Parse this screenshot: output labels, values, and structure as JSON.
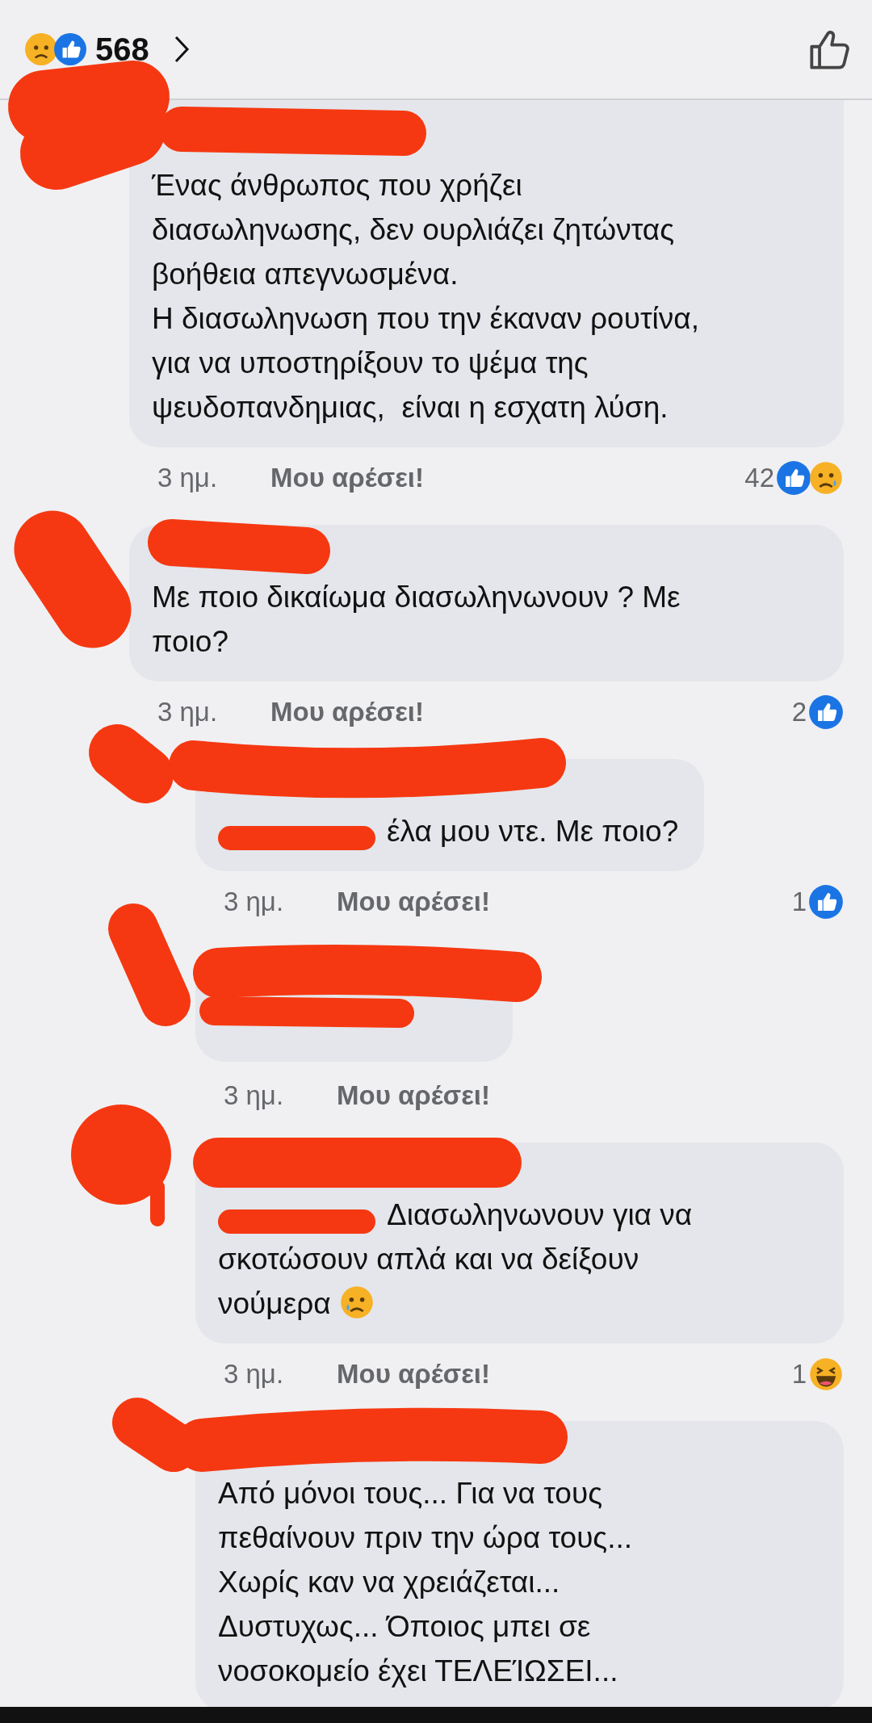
{
  "header": {
    "reactions": [
      {
        "kind": "sad"
      },
      {
        "kind": "like"
      }
    ],
    "count": "568"
  },
  "comments": [
    {
      "text": "Ένας άνθρωπος που χρήζει\nδιασωληνωσης, δεν ουρλιάζει ζητώντας\nβοήθεια απεγνωσμένα.\nΗ διασωληνωση που την έκαναν ρουτίνα,\nγια να υποστηρίξουν το ψέμα της\nψευδοπανδημιας,  είναι η εσχατη λύση.",
      "cut_top": true,
      "mention_hidden": false,
      "time": "3 ημ.",
      "like": "Μου αρέσει!",
      "reaction_count": "42",
      "reactions": [
        {
          "kind": "like"
        },
        {
          "kind": "sad"
        }
      ]
    },
    {
      "text": "Με ποιο δικαίωμα διασωληνωνουν ? Με\nποιο?",
      "cut_top": false,
      "mention_hidden": false,
      "time": "3 ημ.",
      "like": "Μου αρέσει!",
      "reaction_count": "2",
      "reactions": [
        {
          "kind": "like"
        }
      ],
      "children": [
        {
          "text": "έλα μου ντε. Με ποιο?",
          "cut_top": false,
          "mention_hidden": true,
          "time": "3 ημ.",
          "like": "Μου αρέσει!",
          "reaction_count": "1",
          "reactions": [
            {
              "kind": "like"
            }
          ]
        },
        {
          "cut_top": false,
          "mention_hidden": false,
          "time": "3 ημ.",
          "like": "Μου αρέσει!"
        },
        {
          "text": "Διασωληνωνουν για να\nσκοτώσουν απλά και να δείξουν\nνούμερα",
          "emoji": [
            {
              "kind": "sad"
            }
          ],
          "cut_top": false,
          "mention_hidden": true,
          "time": "3 ημ.",
          "like": "Μου αρέσει!",
          "reaction_count": "1",
          "reactions": [
            {
              "kind": "haha"
            }
          ]
        },
        {
          "text": "Από μόνοι τους... Για να τους\nπεθαίνουν πριν την ώρα τους...\nΧωρίς καν να χρειάζεται...\nΔυστυχως... Όποιος μπει σε\nνοσοκομείο έχει ΤΕΛΕΊΩΣΕΙ...",
          "cut_top": false,
          "mention_hidden": false
        }
      ]
    }
  ]
}
